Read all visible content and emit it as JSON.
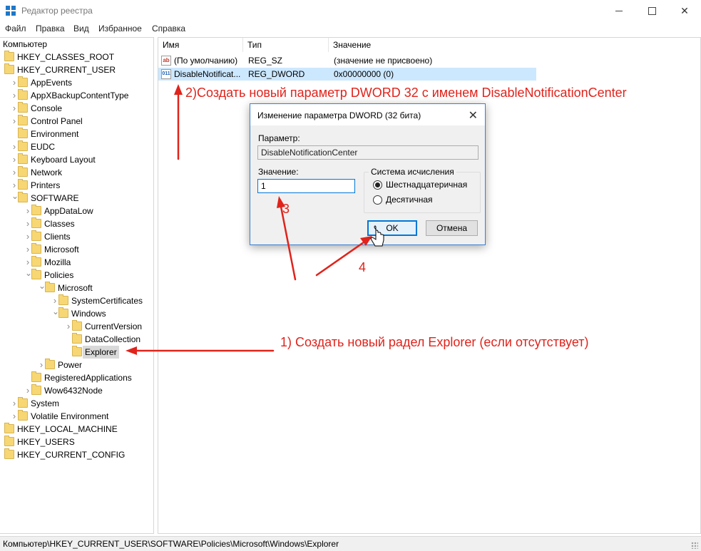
{
  "window": {
    "title": "Редактор реестра"
  },
  "menu": [
    "Файл",
    "Правка",
    "Вид",
    "Избранное",
    "Справка"
  ],
  "tree": {
    "root": "Компьютер",
    "nodes": [
      {
        "label": "HKEY_CLASSES_ROOT",
        "depth": 0,
        "expander": "none"
      },
      {
        "label": "HKEY_CURRENT_USER",
        "depth": 0,
        "expander": "none"
      },
      {
        "label": "AppEvents",
        "depth": 1,
        "expander": "collapsed"
      },
      {
        "label": "AppXBackupContentType",
        "depth": 1,
        "expander": "collapsed"
      },
      {
        "label": "Console",
        "depth": 1,
        "expander": "collapsed"
      },
      {
        "label": "Control Panel",
        "depth": 1,
        "expander": "collapsed"
      },
      {
        "label": "Environment",
        "depth": 1,
        "expander": "none"
      },
      {
        "label": "EUDC",
        "depth": 1,
        "expander": "collapsed"
      },
      {
        "label": "Keyboard Layout",
        "depth": 1,
        "expander": "collapsed"
      },
      {
        "label": "Network",
        "depth": 1,
        "expander": "collapsed"
      },
      {
        "label": "Printers",
        "depth": 1,
        "expander": "collapsed"
      },
      {
        "label": "SOFTWARE",
        "depth": 1,
        "expander": "expanded"
      },
      {
        "label": "AppDataLow",
        "depth": 2,
        "expander": "collapsed"
      },
      {
        "label": "Classes",
        "depth": 2,
        "expander": "collapsed"
      },
      {
        "label": "Clients",
        "depth": 2,
        "expander": "collapsed"
      },
      {
        "label": "Microsoft",
        "depth": 2,
        "expander": "collapsed"
      },
      {
        "label": "Mozilla",
        "depth": 2,
        "expander": "collapsed"
      },
      {
        "label": "Policies",
        "depth": 2,
        "expander": "expanded"
      },
      {
        "label": "Microsoft",
        "depth": 3,
        "expander": "expanded"
      },
      {
        "label": "SystemCertificates",
        "depth": 4,
        "expander": "collapsed"
      },
      {
        "label": "Windows",
        "depth": 4,
        "expander": "expanded"
      },
      {
        "label": "CurrentVersion",
        "depth": 5,
        "expander": "collapsed"
      },
      {
        "label": "DataCollection",
        "depth": 5,
        "expander": "none"
      },
      {
        "label": "Explorer",
        "depth": 5,
        "expander": "none",
        "selected": true
      },
      {
        "label": "Power",
        "depth": 3,
        "expander": "collapsed"
      },
      {
        "label": "RegisteredApplications",
        "depth": 2,
        "expander": "none"
      },
      {
        "label": "Wow6432Node",
        "depth": 2,
        "expander": "collapsed"
      },
      {
        "label": "System",
        "depth": 1,
        "expander": "collapsed"
      },
      {
        "label": "Volatile Environment",
        "depth": 1,
        "expander": "collapsed"
      },
      {
        "label": "HKEY_LOCAL_MACHINE",
        "depth": 0,
        "expander": "none"
      },
      {
        "label": "HKEY_USERS",
        "depth": 0,
        "expander": "none"
      },
      {
        "label": "HKEY_CURRENT_CONFIG",
        "depth": 0,
        "expander": "none"
      }
    ]
  },
  "list": {
    "columns": [
      "Имя",
      "Тип",
      "Значение"
    ],
    "rows": [
      {
        "name": "(По умолчанию)",
        "type": "REG_SZ",
        "value": "(значение не присвоено)",
        "icon": "string-value-icon",
        "icon_glyph": "ab"
      },
      {
        "name": "DisableNotificat...",
        "type": "REG_DWORD",
        "value": "0x00000000 (0)",
        "icon": "binary-value-icon",
        "icon_glyph": "011",
        "selected": true
      }
    ]
  },
  "statusbar": {
    "path": "Компьютер\\HKEY_CURRENT_USER\\SOFTWARE\\Policies\\Microsoft\\Windows\\Explorer"
  },
  "dialog": {
    "title": "Изменение параметра DWORD (32 бита)",
    "param_label": "Параметр:",
    "param_value": "DisableNotificationCenter",
    "value_label": "Значение:",
    "value": "1",
    "base_title": "Система исчисления",
    "radio_hex": "Шестнадцатеричная",
    "radio_dec": "Десятичная",
    "selected_base": "hex",
    "ok": "OK",
    "cancel": "Отмена"
  },
  "annotations": {
    "step1": "1) Создать новый радел Explorer (если отсутствует)",
    "step2": "2)Создать новый параметр DWORD 32 с именем DisableNotificationCenter",
    "step3": "3",
    "step4": "4",
    "color": "#e0231b"
  }
}
